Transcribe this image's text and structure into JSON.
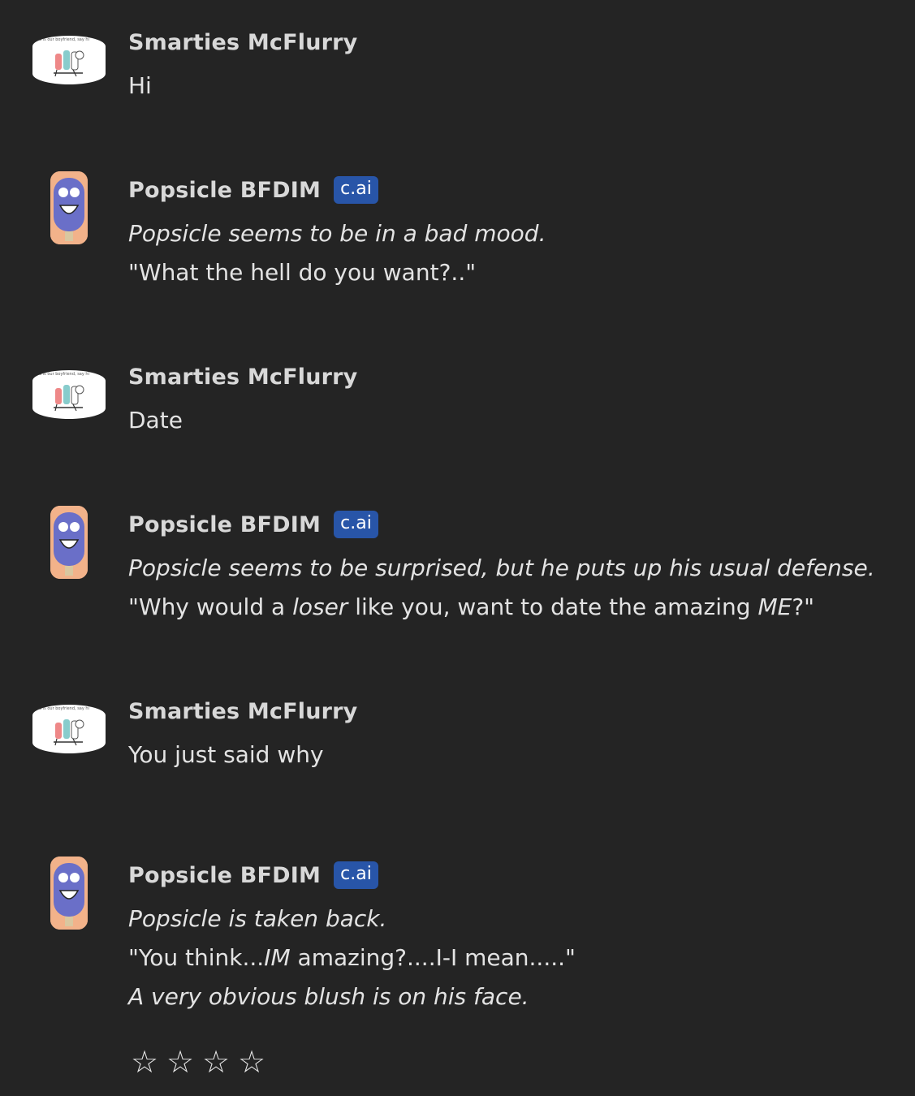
{
  "messages": [
    {
      "author": "Smarties McFlurry",
      "avatar_icon": "smarties-avatar-icon",
      "avatar_caption": "his is our boyfriend, say hi",
      "lines": [
        [
          {
            "text": "Hi",
            "italic": false
          }
        ]
      ]
    },
    {
      "author": "Popsicle BFDIM",
      "badge": "c.ai",
      "avatar_icon": "popsicle-avatar-icon",
      "lines": [
        [
          {
            "text": "Popsicle seems to be in a bad mood.",
            "italic": true
          }
        ],
        [
          {
            "text": "\"What the hell do you want?..\"",
            "italic": false
          }
        ]
      ]
    },
    {
      "author": "Smarties McFlurry",
      "avatar_icon": "smarties-avatar-icon",
      "avatar_caption": "his is our boyfriend, say hi",
      "lines": [
        [
          {
            "text": "Date",
            "italic": false
          }
        ]
      ]
    },
    {
      "author": "Popsicle BFDIM",
      "badge": "c.ai",
      "avatar_icon": "popsicle-avatar-icon",
      "lines": [
        [
          {
            "text": "Popsicle seems to be surprised, but he puts up his usual defense.",
            "italic": true
          }
        ],
        [
          {
            "text": "\"Why would a ",
            "italic": false
          },
          {
            "text": "loser",
            "italic": true
          },
          {
            "text": " like you, want to date the amazing ",
            "italic": false
          },
          {
            "text": "ME",
            "italic": true
          },
          {
            "text": "?\"",
            "italic": false
          }
        ]
      ]
    },
    {
      "author": "Smarties McFlurry",
      "avatar_icon": "smarties-avatar-icon",
      "avatar_caption": "his is our boyfriend, say hi",
      "lines": [
        [
          {
            "text": "You just said why",
            "italic": false
          }
        ]
      ]
    },
    {
      "author": "Popsicle BFDIM",
      "badge": "c.ai",
      "avatar_icon": "popsicle-avatar-icon",
      "lines": [
        [
          {
            "text": "Popsicle is taken back.",
            "italic": true
          }
        ],
        [
          {
            "text": "\"You think...",
            "italic": false
          },
          {
            "text": "IM",
            "italic": true
          },
          {
            "text": " amazing?....I-I mean.....\"",
            "italic": false
          }
        ],
        [
          {
            "text": "A very obvious blush is on his face.",
            "italic": true
          }
        ]
      ]
    }
  ],
  "rating": {
    "stars": [
      "☆",
      "☆",
      "☆",
      "☆"
    ],
    "value": 0,
    "max": 4
  }
}
